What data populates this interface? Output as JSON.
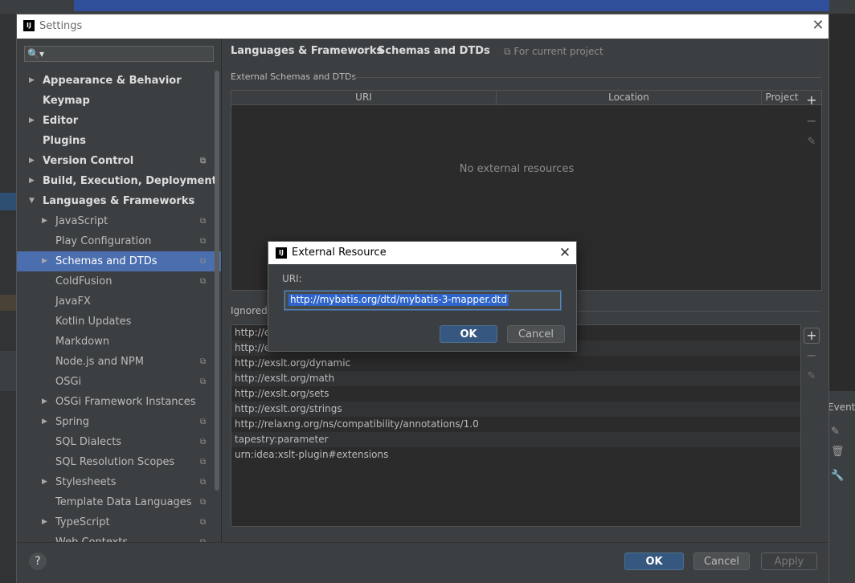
{
  "settings": {
    "title": "Settings",
    "logo": "IJ",
    "close_icon": "✕",
    "search_icon": "🔍▾",
    "sidebar": {
      "items": [
        {
          "label": "Appearance & Behavior",
          "arrow": "▶",
          "level": 0,
          "bold": true,
          "copy": false
        },
        {
          "label": "Keymap",
          "arrow": "",
          "level": 0,
          "bold": true,
          "copy": false
        },
        {
          "label": "Editor",
          "arrow": "▶",
          "level": 0,
          "bold": true,
          "copy": false
        },
        {
          "label": "Plugins",
          "arrow": "",
          "level": 0,
          "bold": true,
          "copy": false
        },
        {
          "label": "Version Control",
          "arrow": "▶",
          "level": 0,
          "bold": true,
          "copy": true
        },
        {
          "label": "Build, Execution, Deployment",
          "arrow": "▶",
          "level": 0,
          "bold": true,
          "copy": false
        },
        {
          "label": "Languages & Frameworks",
          "arrow": "▼",
          "level": 0,
          "bold": true,
          "copy": false
        },
        {
          "label": "JavaScript",
          "arrow": "▶",
          "level": 1,
          "bold": false,
          "copy": true
        },
        {
          "label": "Play Configuration",
          "arrow": "",
          "level": 1,
          "bold": false,
          "copy": true
        },
        {
          "label": "Schemas and DTDs",
          "arrow": "▶",
          "level": 1,
          "bold": false,
          "copy": true,
          "selected": true
        },
        {
          "label": "ColdFusion",
          "arrow": "",
          "level": 1,
          "bold": false,
          "copy": true
        },
        {
          "label": "JavaFX",
          "arrow": "",
          "level": 1,
          "bold": false,
          "copy": false
        },
        {
          "label": "Kotlin Updates",
          "arrow": "",
          "level": 1,
          "bold": false,
          "copy": false
        },
        {
          "label": "Markdown",
          "arrow": "",
          "level": 1,
          "bold": false,
          "copy": false
        },
        {
          "label": "Node.js and NPM",
          "arrow": "",
          "level": 1,
          "bold": false,
          "copy": true
        },
        {
          "label": "OSGi",
          "arrow": "",
          "level": 1,
          "bold": false,
          "copy": true
        },
        {
          "label": "OSGi Framework Instances",
          "arrow": "▶",
          "level": 1,
          "bold": false,
          "copy": false
        },
        {
          "label": "Spring",
          "arrow": "▶",
          "level": 1,
          "bold": false,
          "copy": true
        },
        {
          "label": "SQL Dialects",
          "arrow": "",
          "level": 1,
          "bold": false,
          "copy": true
        },
        {
          "label": "SQL Resolution Scopes",
          "arrow": "",
          "level": 1,
          "bold": false,
          "copy": true
        },
        {
          "label": "Stylesheets",
          "arrow": "▶",
          "level": 1,
          "bold": false,
          "copy": true
        },
        {
          "label": "Template Data Languages",
          "arrow": "",
          "level": 1,
          "bold": false,
          "copy": true
        },
        {
          "label": "TypeScript",
          "arrow": "▶",
          "level": 1,
          "bold": false,
          "copy": true
        },
        {
          "label": "Web Contexts",
          "arrow": "",
          "level": 1,
          "bold": false,
          "copy": true
        }
      ]
    },
    "breadcrumb": {
      "part1": "Languages & Frameworks",
      "separator": "›",
      "part2": "Schemas and DTDs",
      "scope": "⧉ For current project"
    },
    "external": {
      "label": "External Schemas and DTDs",
      "columns": [
        "URI",
        "Location",
        "Project"
      ],
      "empty_text": "No external resources",
      "add_icon": "+",
      "remove_icon": "−",
      "edit_icon": "✎"
    },
    "ignored": {
      "label": "Ignored S",
      "rows": [
        "http://e",
        "http://e",
        "http://exslt.org/dynamic",
        "http://exslt.org/math",
        "http://exslt.org/sets",
        "http://exslt.org/strings",
        "http://relaxng.org/ns/compatibility/annotations/1.0",
        "tapestry:parameter",
        "urn:idea:xslt-plugin#extensions"
      ],
      "add_icon": "+",
      "remove_icon": "−",
      "edit_icon": "✎"
    },
    "footer": {
      "help": "?",
      "ok": "OK",
      "cancel": "Cancel",
      "apply": "Apply"
    }
  },
  "dialog": {
    "logo": "IJ",
    "title": "External Resource",
    "close_icon": "✕",
    "uri_label": "URI:",
    "uri_value": "http://mybatis.org/dtd/mybatis-3-mapper.dtd",
    "ok": "OK",
    "cancel": "Cancel"
  },
  "background": {
    "events_label": "Event"
  }
}
